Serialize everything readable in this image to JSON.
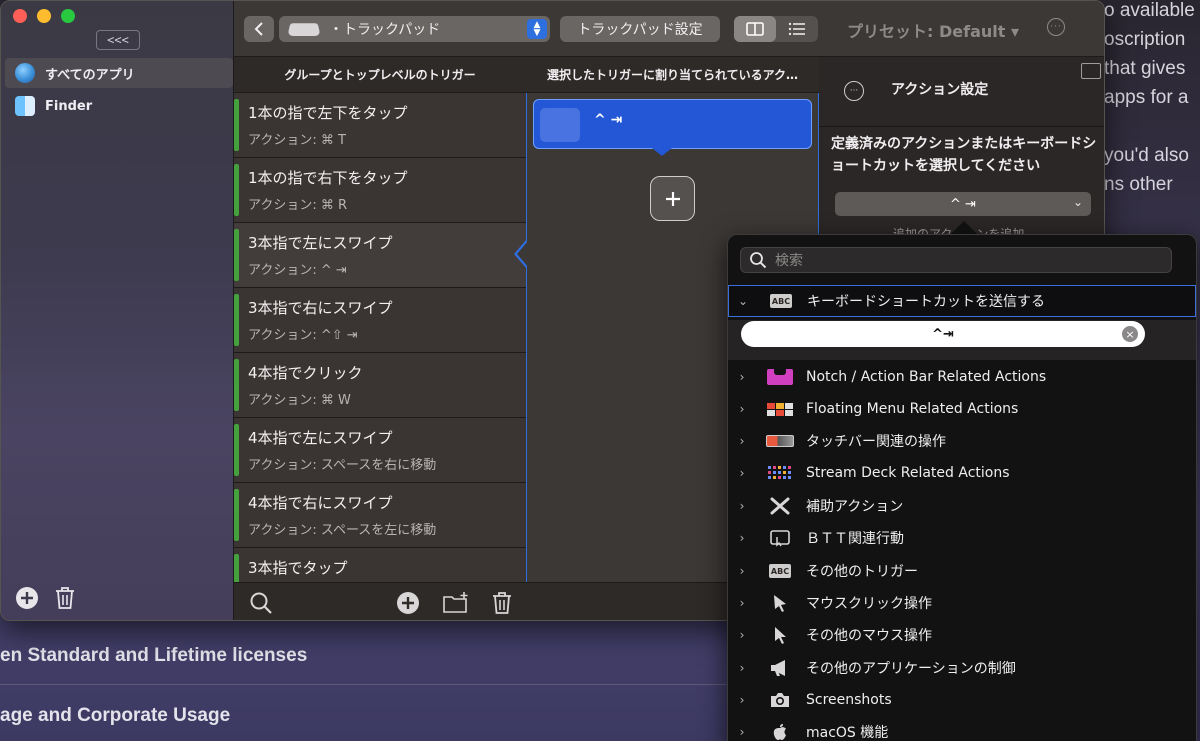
{
  "background": {
    "right_lines": [
      "o available",
      "oscription",
      "that gives",
      "apps for a",
      "",
      "you'd also",
      "ns other"
    ],
    "headings": [
      "en Standard and Lifetime licenses",
      "age and Corporate Usage"
    ]
  },
  "sidebar": {
    "collapse_label": "<<<",
    "items": [
      {
        "label": "すべてのアプリ",
        "icon": "globe-icon"
      },
      {
        "label": "Finder",
        "icon": "finder-icon"
      }
    ]
  },
  "toolbar": {
    "back_label": "<",
    "device_select": "・トラックパッド",
    "trackpad_settings_label": "トラックパッド設定",
    "preset_label": "プリセット: Default ▾",
    "more_label": "···"
  },
  "columns": {
    "triggers_header": "グループとトップレベルのトリガー",
    "actions_header": "選択したトリガーに割り当てられているアク…",
    "settings_title": "アクション設定"
  },
  "triggers": [
    {
      "title": "1本の指で左下をタップ",
      "action": "アクション: ⌘ T"
    },
    {
      "title": "1本の指で右下をタップ",
      "action": "アクション: ⌘ R"
    },
    {
      "title": "3本指で左にスワイプ",
      "action": "アクション: ^ ⇥"
    },
    {
      "title": "3本指で右にスワイプ",
      "action": "アクション: ^⇧ ⇥"
    },
    {
      "title": "4本指でクリック",
      "action": "アクション: ⌘ W"
    },
    {
      "title": "4本指で左にスワイプ",
      "action": "アクション: スペースを右に移動"
    },
    {
      "title": "4本指で右にスワイプ",
      "action": "アクション: スペースを左に移動"
    },
    {
      "title": "3本指でタップ",
      "action": ""
    }
  ],
  "selected_action": {
    "label": "^ ⇥"
  },
  "settings": {
    "description": "定義済みのアクションまたはキーボードショートカットを選択してください",
    "dropdown_value": "^ ⇥",
    "add_action_label": "追加のアクションを追加"
  },
  "popover": {
    "search_placeholder": "検索",
    "expanded_row": "キーボードショートカットを送信する",
    "shortcut_value": "^⇥",
    "categories": [
      {
        "label": "Notch / Action Bar Related Actions",
        "icon": "notch-icon"
      },
      {
        "label": "Floating Menu Related Actions",
        "icon": "floating-menu-icon"
      },
      {
        "label": "タッチバー関連の操作",
        "icon": "touchbar-icon"
      },
      {
        "label": "Stream Deck Related Actions",
        "icon": "stream-deck-icon"
      },
      {
        "label": "補助アクション",
        "icon": "tools-icon"
      },
      {
        "label": "ＢＴＴ関連行動",
        "icon": "btt-icon"
      },
      {
        "label": "その他のトリガー",
        "icon": "abc-icon"
      },
      {
        "label": "マウスクリック操作",
        "icon": "mouse-click-icon"
      },
      {
        "label": "その他のマウス操作",
        "icon": "mouse-pointer-icon"
      },
      {
        "label": "その他のアプリケーションの制御",
        "icon": "megaphone-icon"
      },
      {
        "label": "Screenshots",
        "icon": "camera-icon"
      },
      {
        "label": "macOS 機能",
        "icon": "apple-icon"
      }
    ]
  },
  "colors": {
    "accent_blue": "#2457d6",
    "trigger_bar_green": "#45a13e",
    "traffic_red": "#ff5f57",
    "traffic_yellow": "#febc2e",
    "traffic_green": "#28c840"
  }
}
